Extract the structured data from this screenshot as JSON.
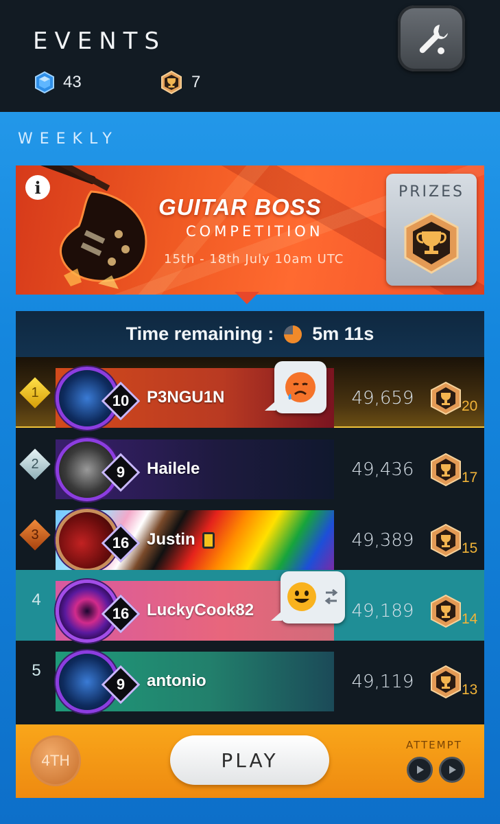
{
  "header": {
    "title": "EVENTS",
    "gems": "43",
    "trophies": "7"
  },
  "section": {
    "label": "WEEKLY"
  },
  "banner": {
    "title": "GUITAR BOSS",
    "subtitle": "COMPETITION",
    "dates": "15th - 18th July 10am UTC",
    "prizes_label": "PRIZES"
  },
  "leaderboard": {
    "time_label": "Time remaining :",
    "time_value": "5m 11s",
    "rows": [
      {
        "rank": "1",
        "level": "10",
        "name": "P3NGU1N",
        "score": "49,659",
        "trophies": "20"
      },
      {
        "rank": "2",
        "level": "9",
        "name": "Hailele",
        "score": "49,436",
        "trophies": "17"
      },
      {
        "rank": "3",
        "level": "16",
        "name": "Justin",
        "score": "49,389",
        "trophies": "15"
      },
      {
        "rank": "4",
        "level": "16",
        "name": "LuckyCook82",
        "score": "49,189",
        "trophies": "14"
      },
      {
        "rank": "5",
        "level": "9",
        "name": "antonio",
        "score": "49,119",
        "trophies": "13"
      }
    ]
  },
  "footer": {
    "place": "4TH",
    "play_label": "PLAY",
    "attempt_label": "ATTEMPT"
  },
  "colors": {
    "accent_orange": "#f9a61a",
    "gold": "#f2b438",
    "highlight_teal": "#1f8e96"
  }
}
